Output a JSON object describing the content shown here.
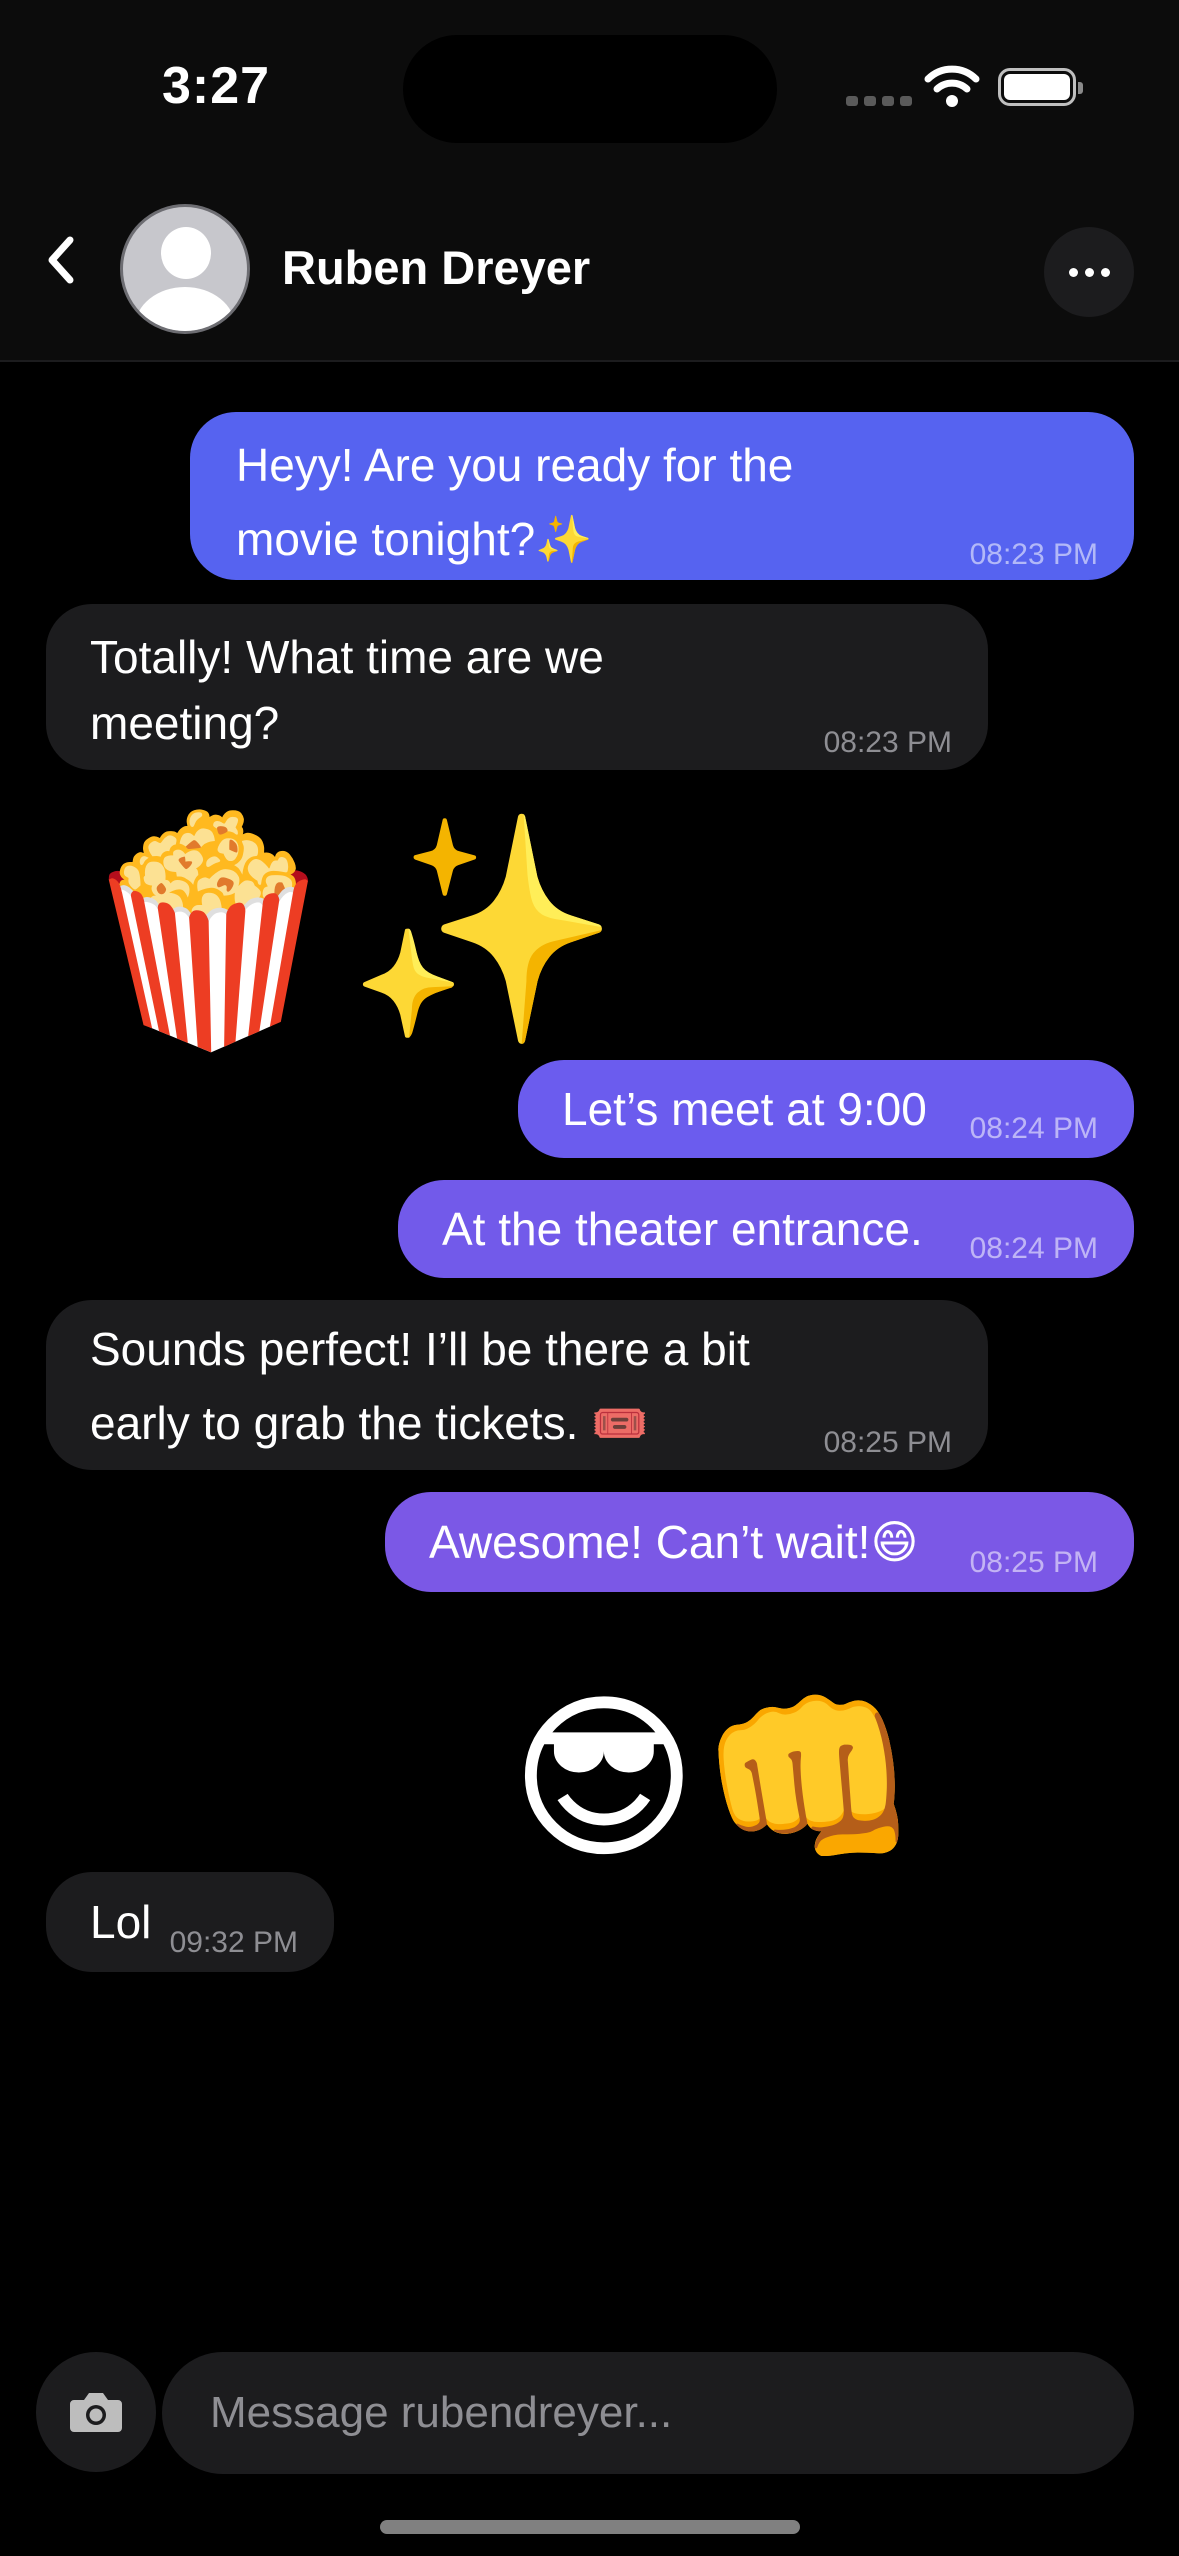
{
  "status_bar": {
    "time": "3:27",
    "icons": [
      "cellular-signal-icon",
      "wifi-icon",
      "battery-icon"
    ]
  },
  "header": {
    "contact_name": "Ruben Dreyer",
    "icons": {
      "back": "chevron-left-icon",
      "avatar": "person-placeholder-icon",
      "more": "ellipsis-icon"
    }
  },
  "messages": [
    {
      "direction": "outgoing",
      "lines": [
        "Heyy! Are you ready for the",
        "movie tonight?✨"
      ],
      "time": "08:23 PM",
      "color": "#5663F0"
    },
    {
      "direction": "incoming",
      "lines": [
        "Totally! What time are we",
        "meeting?"
      ],
      "time": "08:23 PM"
    },
    {
      "direction": "incoming",
      "type": "sticker",
      "emoji": "🍿✨"
    },
    {
      "direction": "outgoing",
      "lines": [
        "Let’s meet at 9:00"
      ],
      "time": "08:24 PM",
      "color": "#6B5CEE"
    },
    {
      "direction": "outgoing",
      "lines": [
        "At the theater entrance."
      ],
      "time": "08:24 PM",
      "color": "#725AEA"
    },
    {
      "direction": "incoming",
      "lines": [
        "Sounds perfect! I’ll be there a bit",
        "early to grab the tickets. 🎟️"
      ],
      "time": "08:25 PM"
    },
    {
      "direction": "outgoing",
      "lines": [
        "Awesome! Can’t wait!😄"
      ],
      "time": "08:25 PM",
      "color": "#7B58E6"
    },
    {
      "direction": "incoming",
      "type": "sticker",
      "emoji": "😎👊"
    },
    {
      "direction": "incoming",
      "lines": [
        "Lol"
      ],
      "time": "09:32 PM"
    }
  ],
  "composer": {
    "placeholder": "Message rubendreyer...",
    "icons": {
      "camera": "camera-icon"
    }
  },
  "colors": {
    "background": "#000000",
    "incoming_bubble": "#1C1C1E",
    "header": "#0C0C0C"
  }
}
